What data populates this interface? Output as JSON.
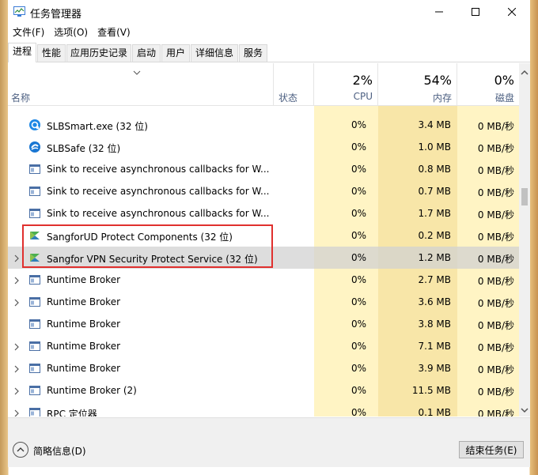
{
  "window": {
    "title": "任务管理器"
  },
  "menu": [
    "文件(F)",
    "选项(O)",
    "查看(V)"
  ],
  "tabs": [
    "进程",
    "性能",
    "应用历史记录",
    "启动",
    "用户",
    "详细信息",
    "服务"
  ],
  "columns": {
    "name": "名称",
    "status": "状态",
    "cpu": {
      "percent": "2%",
      "label": "CPU"
    },
    "memory": {
      "percent": "54%",
      "label": "内存"
    },
    "disk": {
      "percent": "0%",
      "label": "磁盘"
    }
  },
  "rows": [
    {
      "name": "SLBSmart.exe (32 位)",
      "cpu": "0%",
      "mem": "3.4 MB",
      "disk": "0 MB/秒",
      "icon": "slbsmart-icon",
      "expandable": false
    },
    {
      "name": "SLBSafe (32 位)",
      "cpu": "0%",
      "mem": "1.0 MB",
      "disk": "0 MB/秒",
      "icon": "slbsafe-icon",
      "expandable": false
    },
    {
      "name": "Sink to receive asynchronous callbacks for W...",
      "cpu": "0%",
      "mem": "0.8 MB",
      "disk": "0 MB/秒",
      "icon": "window-app-icon",
      "expandable": false
    },
    {
      "name": "Sink to receive asynchronous callbacks for W...",
      "cpu": "0%",
      "mem": "0.7 MB",
      "disk": "0 MB/秒",
      "icon": "window-app-icon",
      "expandable": false
    },
    {
      "name": "Sink to receive asynchronous callbacks for W...",
      "cpu": "0%",
      "mem": "1.7 MB",
      "disk": "0 MB/秒",
      "icon": "window-app-icon",
      "expandable": false
    },
    {
      "name": "SangforUD Protect Components (32 位)",
      "cpu": "0%",
      "mem": "0.2 MB",
      "disk": "0 MB/秒",
      "icon": "sangfor-icon",
      "expandable": false
    },
    {
      "name": "Sangfor VPN Security Protect Service (32 位)",
      "cpu": "0%",
      "mem": "1.2 MB",
      "disk": "0 MB/秒",
      "icon": "sangfor-icon",
      "expandable": true,
      "selected": true
    },
    {
      "name": "Runtime Broker",
      "cpu": "0%",
      "mem": "2.7 MB",
      "disk": "0 MB/秒",
      "icon": "window-app-icon",
      "expandable": true
    },
    {
      "name": "Runtime Broker",
      "cpu": "0%",
      "mem": "3.6 MB",
      "disk": "0 MB/秒",
      "icon": "window-app-icon",
      "expandable": true
    },
    {
      "name": "Runtime Broker",
      "cpu": "0%",
      "mem": "3.8 MB",
      "disk": "0 MB/秒",
      "icon": "window-app-icon",
      "expandable": false
    },
    {
      "name": "Runtime Broker",
      "cpu": "0%",
      "mem": "7.1 MB",
      "disk": "0 MB/秒",
      "icon": "window-app-icon",
      "expandable": true
    },
    {
      "name": "Runtime Broker",
      "cpu": "0%",
      "mem": "3.9 MB",
      "disk": "0 MB/秒",
      "icon": "window-app-icon",
      "expandable": true
    },
    {
      "name": "Runtime Broker (2)",
      "cpu": "0%",
      "mem": "11.5 MB",
      "disk": "0 MB/秒",
      "icon": "window-app-icon",
      "expandable": true
    },
    {
      "name": "RPC 定位器",
      "cpu": "0%",
      "mem": "0.1 MB",
      "disk": "0 MB/秒",
      "icon": "window-app-icon",
      "expandable": true
    }
  ],
  "footer": {
    "fewer_details": "简略信息(D)",
    "end_task": "结束任务(E)"
  },
  "colors": {
    "cpu_bg": "#fff4c4",
    "mem_bg": "#f8e6a8",
    "highlight": "#e0302e"
  }
}
